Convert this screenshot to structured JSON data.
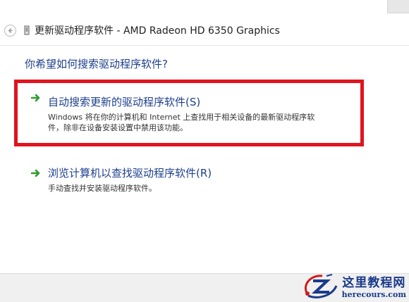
{
  "window": {
    "title": "更新驱动程序软件 - AMD Radeon HD 6350 Graphics"
  },
  "question": "你希望如何搜索驱动程序软件?",
  "options": [
    {
      "title": "自动搜索更新的驱动程序软件(S)",
      "description_line1": "Windows 将在你的计算机和 Internet 上查找用于相关设备的最新驱动程序软",
      "description_line2": "件，除非在设备安装设置中禁用该功能。",
      "icon": "green-arrow-icon"
    },
    {
      "title": "浏览计算机以查找驱动程序软件(R)",
      "description_line1": "手动查找并安装驱动程序软件。",
      "icon": "green-arrow-icon"
    }
  ],
  "watermark": {
    "name_cn": "这里教程网",
    "domain": "herecours.com"
  },
  "colors": {
    "link_blue": "#1d3f8c",
    "highlight_red": "#e1141e",
    "arrow_green": "#2e9e2e"
  }
}
